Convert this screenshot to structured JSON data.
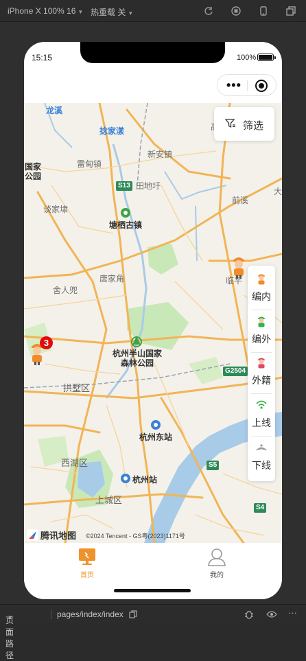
{
  "ide": {
    "device_select": "iPhone X 100% 16",
    "hotreload_select": "热重载 关",
    "icons": [
      "rotate-icon",
      "record-icon",
      "phone-icon",
      "window-icon"
    ]
  },
  "status_bar": {
    "time": "15:15",
    "battery": "100%"
  },
  "map": {
    "filter_label": "筛选",
    "places": [
      {
        "text": "龙溪",
        "style": "blue"
      },
      {
        "text": "捻家漾",
        "style": "blue"
      },
      {
        "text": "新安镇",
        "style": "normal"
      },
      {
        "text": "雷甸镇",
        "style": "normal"
      },
      {
        "text": "田地圩",
        "style": "normal"
      },
      {
        "text": "前溪",
        "style": "normal"
      },
      {
        "text": "谈家埭",
        "style": "normal"
      },
      {
        "text": "塘栖古镇",
        "style": "dark"
      },
      {
        "text": "唐家角",
        "style": "normal"
      },
      {
        "text": "舍人兜",
        "style": "normal"
      },
      {
        "text": "临平",
        "style": "normal"
      },
      {
        "text": "杭州半山国家",
        "style": "dark"
      },
      {
        "text": "森林公园",
        "style": "dark"
      },
      {
        "text": "拱墅区",
        "style": "big"
      },
      {
        "text": "杭州东站",
        "style": "dark"
      },
      {
        "text": "西湖区",
        "style": "big"
      },
      {
        "text": "杭州站",
        "style": "dark"
      },
      {
        "text": "上城区",
        "style": "big"
      },
      {
        "text": "国家",
        "style": "dark"
      },
      {
        "text": "公园",
        "style": "dark"
      },
      {
        "text": "高",
        "style": "normal"
      },
      {
        "text": "大",
        "style": "normal"
      }
    ],
    "highways": [
      "S13",
      "G2504",
      "S5",
      "S4"
    ],
    "cluster_badge": "3",
    "logo_text": "腾讯地图",
    "copyright": "©2024 Tencent - GS粤(2023)1171号"
  },
  "legend": [
    {
      "label": "编内",
      "icon": "worker-orange-icon",
      "color": "#f08c2a"
    },
    {
      "label": "编外",
      "icon": "worker-green-icon",
      "color": "#2fb34f"
    },
    {
      "label": "外籍",
      "icon": "worker-pink-icon",
      "color": "#e2476b"
    },
    {
      "label": "上线",
      "icon": "wifi-online-icon",
      "color": "#32b34a"
    },
    {
      "label": "下线",
      "icon": "wifi-offline-icon",
      "color": "#9a9a9a"
    }
  ],
  "tabbar": {
    "home_label": "首页",
    "mine_label": "我的",
    "active_color": "#f0922b"
  },
  "bottom_bar": {
    "path_label": "页面路径",
    "path_value": "pages/index/index"
  }
}
